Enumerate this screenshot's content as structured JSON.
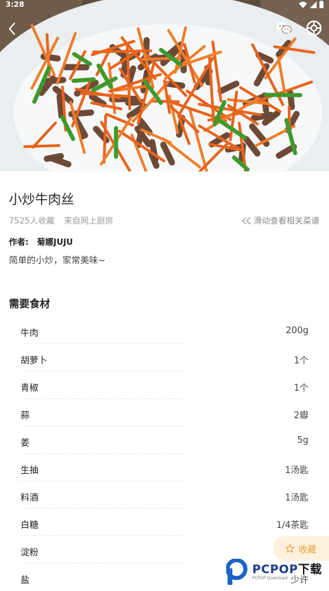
{
  "status_bar": {
    "time": "3:28"
  },
  "header": {
    "back_icon": "chevron-left-icon",
    "share_icons": [
      "wechat-icon",
      "moments-icon"
    ]
  },
  "recipe": {
    "title": "小炒牛肉丝",
    "favorites": "7525人收藏",
    "source": "来自网上厨房",
    "swipe_hint": "滑动查看相关菜谱",
    "author_label": "作者:",
    "author_name": "菊娜JUJU",
    "description": "简单的小炒，家常美味~"
  },
  "ingredients": {
    "title": "需要食材",
    "items": [
      {
        "name": "牛肉",
        "amount": "200g"
      },
      {
        "name": "胡萝卜",
        "amount": "1个"
      },
      {
        "name": "青椒",
        "amount": "1个"
      },
      {
        "name": "蒜",
        "amount": "2瓣"
      },
      {
        "name": "姜",
        "amount": "5g"
      },
      {
        "name": "生抽",
        "amount": "1汤匙"
      },
      {
        "name": "料酒",
        "amount": "1汤匙"
      },
      {
        "name": "白糖",
        "amount": "1/4茶匙"
      },
      {
        "name": "淀粉",
        "amount": ""
      },
      {
        "name": "盐",
        "amount": "少许"
      }
    ]
  },
  "favorite_button": {
    "label": "收藏",
    "icon": "star-icon",
    "color": "#e9a23b"
  },
  "watermark": {
    "brand": "PCPOP",
    "brand_suffix": "下载",
    "sub": "PCPOP Download"
  }
}
